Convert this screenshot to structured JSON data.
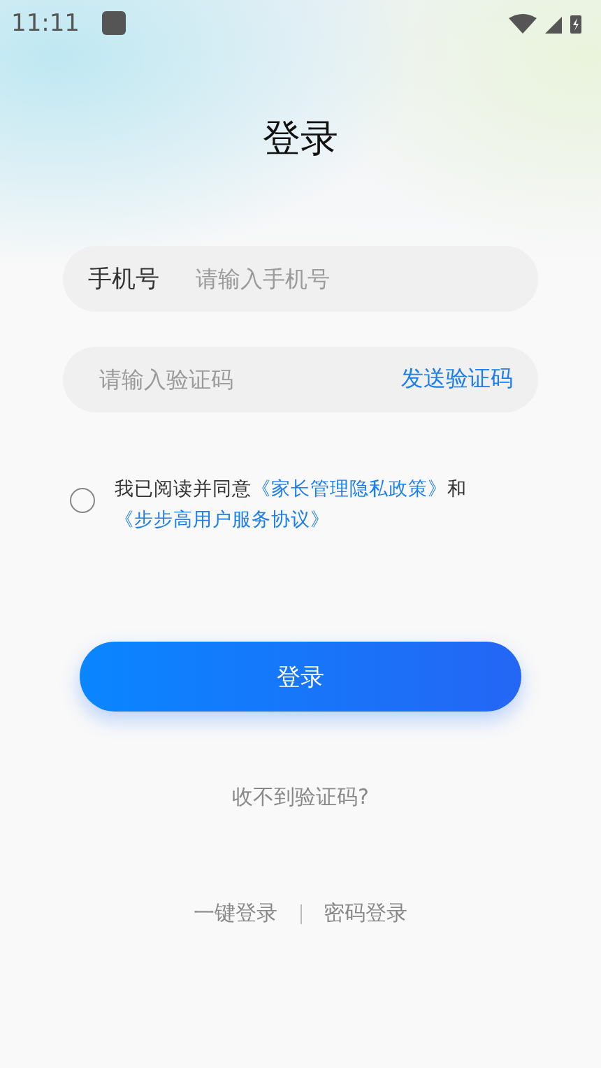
{
  "status_bar": {
    "time": "11:11"
  },
  "title": "登录",
  "phone_field": {
    "label": "手机号",
    "placeholder": "请输入手机号"
  },
  "code_field": {
    "placeholder": "请输入验证码",
    "action": "发送验证码"
  },
  "agreement": {
    "checked": false,
    "parts": [
      {
        "kind": "text",
        "text": "我已阅读并同意"
      },
      {
        "kind": "link",
        "text": "《家长管理隐私政策》"
      },
      {
        "kind": "text",
        "text": "和"
      },
      {
        "kind": "link",
        "text": "《步步高用户服务协议》"
      }
    ]
  },
  "login_button": "登录",
  "no_code_link": "收不到验证码?",
  "bottom_links": [
    "一键登录",
    "密码登录"
  ]
}
